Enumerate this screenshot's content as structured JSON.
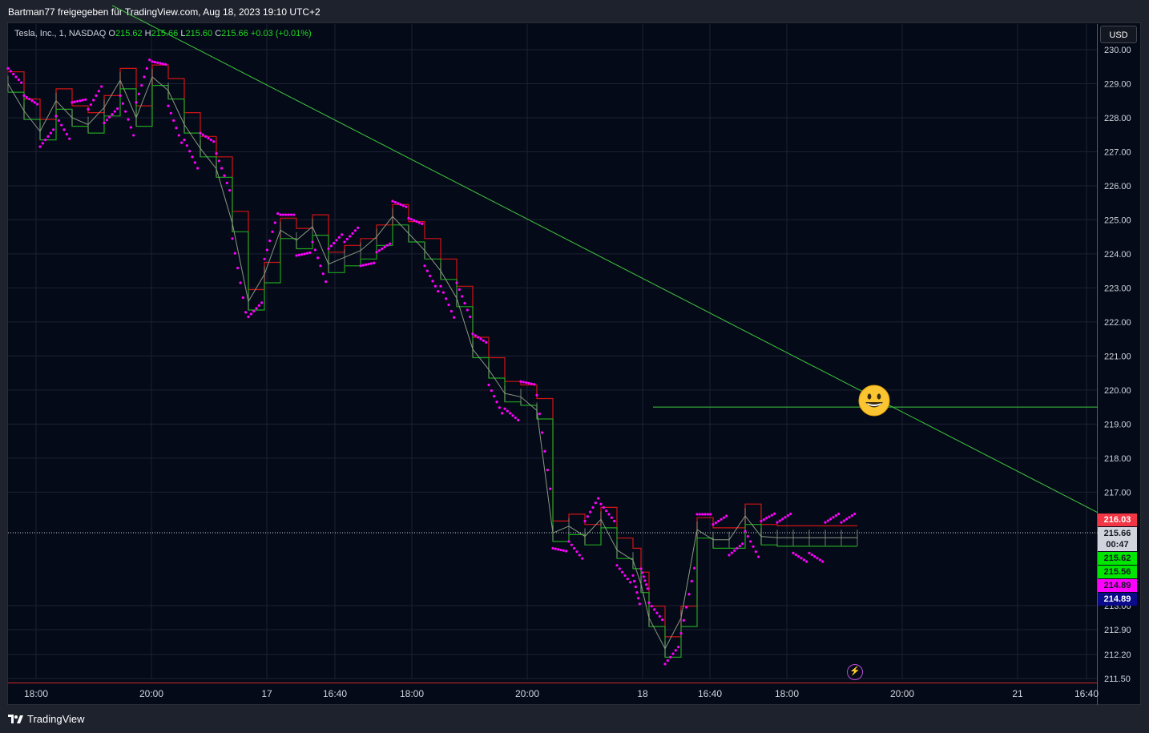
{
  "header": {
    "title": "Bartman77 freigegeben für TradingView.com, Aug 18, 2023 19:10 UTC+2"
  },
  "legend": {
    "symbol": "Tesla, Inc., 1, NASDAQ",
    "open_label": "O",
    "open": "215.62",
    "high_label": "H",
    "high": "215.66",
    "low_label": "L",
    "low": "215.60",
    "close_label": "C",
    "close": "215.66",
    "change": "+0.03 (+0.01%)"
  },
  "currency_button": "USD",
  "footer": {
    "brand": "TradingView"
  },
  "price_tags": [
    {
      "text": "216.03",
      "bg": "#f23645",
      "fg": "#ffffff"
    },
    {
      "text": "215.66",
      "bg": "#d1d4dc",
      "fg": "#131722"
    },
    {
      "text": "00:47",
      "bg": "#d1d4dc",
      "fg": "#131722"
    },
    {
      "text": "215.62",
      "bg": "#00e600",
      "fg": "#131722"
    },
    {
      "text": "215.56",
      "bg": "#00e600",
      "fg": "#131722"
    },
    {
      "text": "214.89",
      "bg": "#ff00ff",
      "fg": "#131722"
    },
    {
      "text": "214.89",
      "bg": "#0a0a8a",
      "fg": "#ffffff"
    }
  ],
  "icons": {
    "emoji": "smiley-face-icon",
    "bolt": "lightning-icon",
    "logo": "tradingview-logo-icon"
  },
  "colors": {
    "price": "#8a9a80",
    "trend_line": "#3ec93e",
    "psar": "#ff00ff",
    "ma_red": "#d01515",
    "ma_green": "#1fa31f"
  },
  "chart_data": {
    "type": "candlestick",
    "title": "Tesla, Inc., 1, NASDAQ",
    "xlabel": "",
    "ylabel": "",
    "ylim": [
      211.5,
      230.0
    ],
    "grid": true,
    "y_ticks": [
      "230.00",
      "229.00",
      "228.00",
      "227.00",
      "226.00",
      "225.00",
      "224.00",
      "223.00",
      "222.00",
      "221.00",
      "220.00",
      "219.00",
      "218.00",
      "217.00",
      "213.00",
      "212.90",
      "212.20",
      "211.50"
    ],
    "x_ticks": [
      "18:00",
      "20:00",
      "17",
      "16:40",
      "18:00",
      "20:00",
      "18",
      "16:40",
      "18:00",
      "20:00",
      "21",
      "16:40"
    ],
    "current_price": 215.66,
    "series": [
      {
        "name": "Price",
        "x": [
          0,
          20,
          40,
          60,
          80,
          100,
          120,
          140,
          160,
          180,
          200,
          220,
          240,
          260,
          280,
          300,
          320,
          340,
          360,
          380,
          400,
          420,
          440,
          460,
          480,
          500,
          520,
          540,
          560,
          580,
          600,
          620,
          640,
          660,
          680,
          700,
          720,
          740,
          760,
          780,
          790,
          800,
          820,
          840,
          860,
          880,
          900,
          920,
          940,
          960,
          980,
          1000,
          1020,
          1040,
          1060
        ],
        "values": [
          229.0,
          228.2,
          227.6,
          228.5,
          228.0,
          227.8,
          228.3,
          229.1,
          228.0,
          229.2,
          228.8,
          227.8,
          227.1,
          226.5,
          224.9,
          222.6,
          223.4,
          224.7,
          224.4,
          224.8,
          223.7,
          223.9,
          224.1,
          224.5,
          225.1,
          224.6,
          224.1,
          223.5,
          222.7,
          221.2,
          220.6,
          219.9,
          219.8,
          219.4,
          215.8,
          216.0,
          215.7,
          216.2,
          215.3,
          215.0,
          214.3,
          213.3,
          212.4,
          213.3,
          215.9,
          215.6,
          215.6,
          216.3,
          215.7,
          215.66,
          215.66,
          215.66,
          215.66,
          215.66,
          215.66
        ]
      },
      {
        "name": "Trend line",
        "x": [
          140,
          1370
        ],
        "values": [
          231.3,
          216.4
        ]
      },
      {
        "name": "Level line",
        "x": [
          815,
          1370
        ],
        "values": [
          219.5,
          219.5
        ]
      }
    ]
  }
}
